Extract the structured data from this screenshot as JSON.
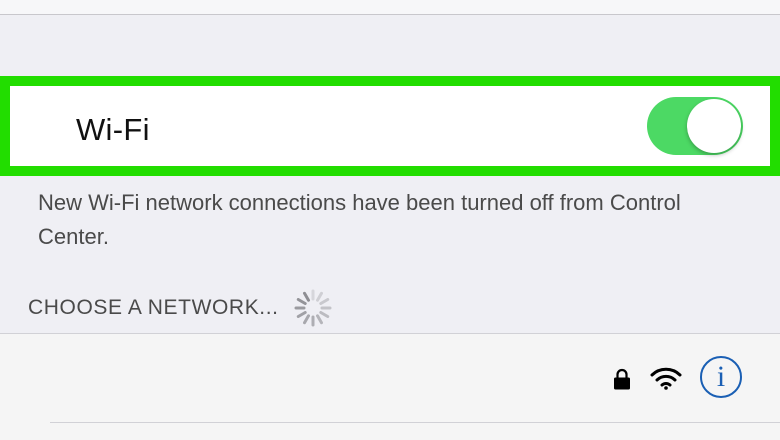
{
  "wifi": {
    "label": "Wi-Fi",
    "enabled": true,
    "toggle_on_color": "#4cd964",
    "highlight_color": "#22dd00"
  },
  "footer_note": "New Wi-Fi network connections have been turned off from Control Center.",
  "networks_section": {
    "header": "CHOOSE A NETWORK...",
    "loading_icon": "spinner-icon"
  },
  "network": {
    "name": "",
    "secured_icon": "lock-icon",
    "signal_icon": "wifi-signal-icon",
    "info_label": "i",
    "info_icon": "info-icon",
    "info_color": "#1a5fb4"
  }
}
